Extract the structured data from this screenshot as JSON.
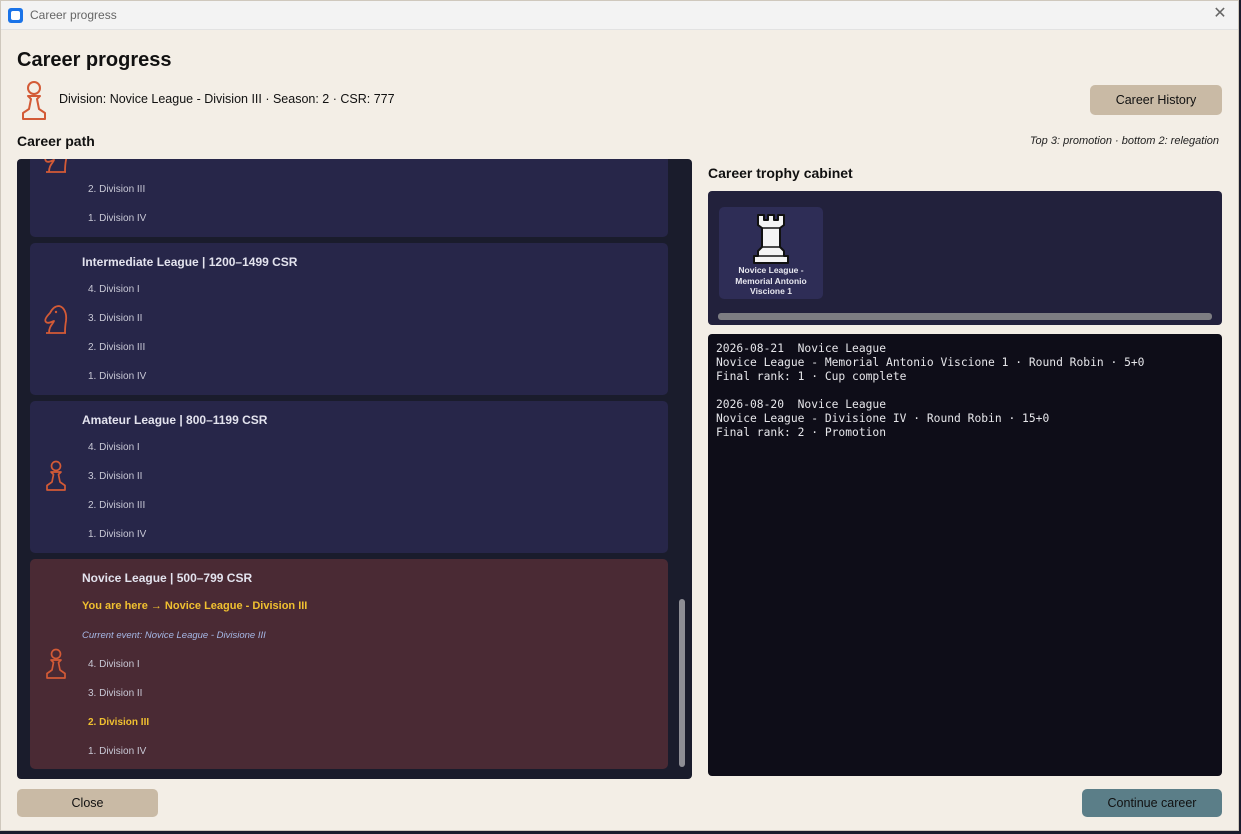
{
  "window": {
    "title": "Career progress",
    "close_glyph": "✕"
  },
  "header": {
    "title": "Career progress",
    "icon": "pawn-icon",
    "status": "Division: Novice League - Division III · Season: 2 · CSR: 777",
    "history_button": "Career History"
  },
  "career_path": {
    "title": "Career path",
    "legend": "Top 3: promotion · bottom 2: relegation",
    "top_partial": {
      "icon": "knight-icon",
      "divisions": [
        "2. Division III",
        "1. Division IV"
      ]
    },
    "leagues": [
      {
        "name": "Intermediate League  |  1200–1499 CSR",
        "icon": "knight-icon",
        "divisions": [
          "4. Division I",
          "3. Division II",
          "2. Division III",
          "1. Division IV"
        ]
      },
      {
        "name": "Amateur League  |  800–1199 CSR",
        "icon": "pawn-icon",
        "divisions": [
          "4. Division I",
          "3. Division II",
          "2. Division III",
          "1. Division IV"
        ]
      },
      {
        "name": "Novice League  |  500–799 CSR",
        "icon": "pawn-icon",
        "current": true,
        "here": "You are here  →  Novice League - Division III",
        "event": "Current event: Novice League - Divisione III",
        "divisions": [
          "4. Division I",
          "3. Division II",
          "2. Division III",
          "1. Division IV"
        ],
        "active_division_index": 2
      }
    ]
  },
  "cabinet": {
    "title": "Career trophy cabinet",
    "trophies": [
      {
        "icon": "rook-icon",
        "label": "Novice League - Memorial Antonio Viscione 1"
      }
    ]
  },
  "log": {
    "entries": [
      {
        "header": "2026-08-21  Novice League",
        "detail": "Novice League - Memorial Antonio Viscione 1 · Round Robin · 5+0",
        "result": "Final rank: 1 · Cup complete"
      },
      {
        "header": "2026-08-20  Novice League",
        "detail": "Novice League - Divisione IV · Round Robin · 15+0",
        "result": "Final rank: 2 · Promotion"
      }
    ]
  },
  "footer": {
    "close": "Close",
    "continue": "Continue career"
  },
  "colors": {
    "accent_orange": "#d35a36",
    "highlight_gold": "#f0c030",
    "card_blue": "#272649",
    "card_current": "#4a2a34",
    "continue_button": "#5b7e88",
    "neutral_button": "#c9baa5"
  }
}
